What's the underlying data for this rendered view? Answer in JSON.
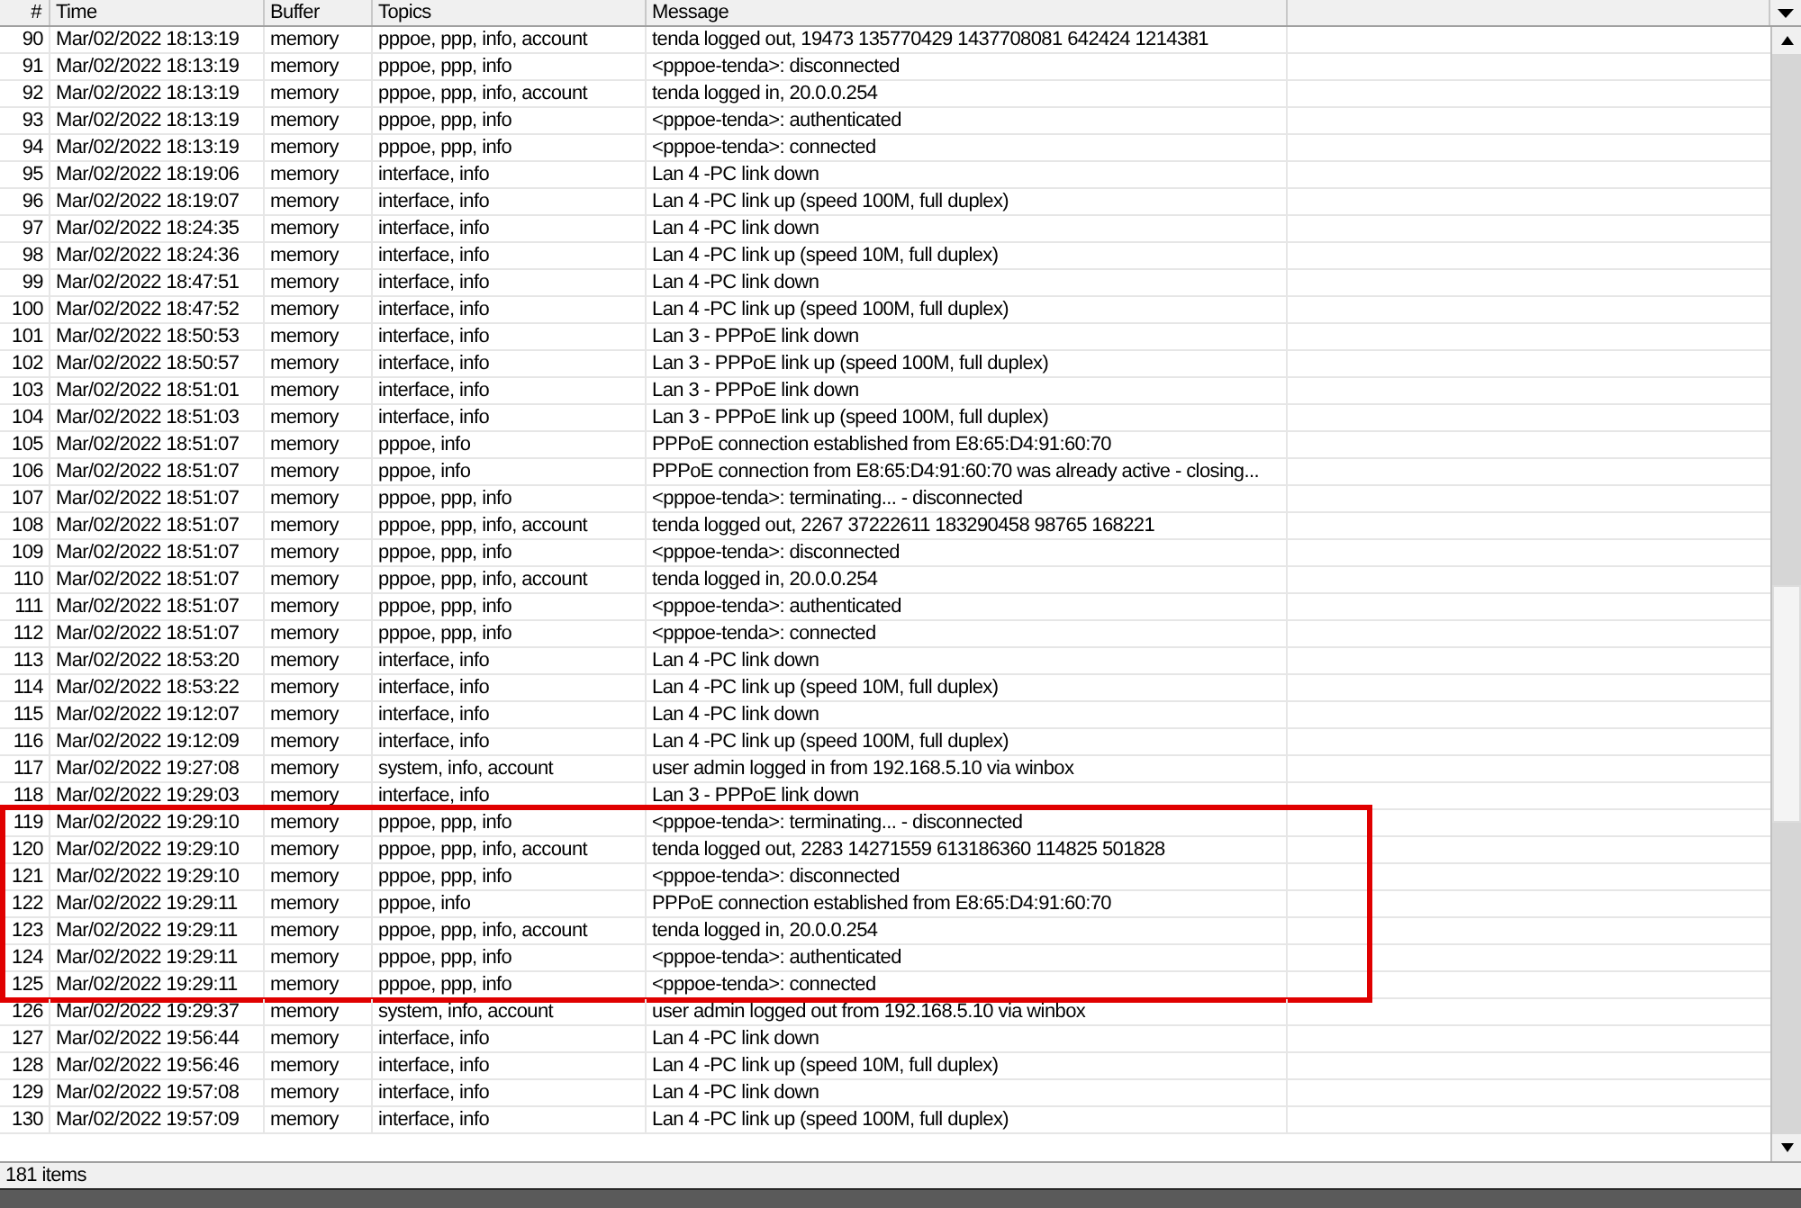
{
  "table": {
    "columns": [
      "#",
      "Time",
      "Buffer",
      "Topics",
      "Message"
    ],
    "rows": [
      {
        "num": "90",
        "time": "Mar/02/2022 18:13:19",
        "buffer": "memory",
        "topics": "pppoe, ppp, info, account",
        "message": "tenda logged out, 19473 135770429 1437708081 642424 1214381",
        "highlighted": false
      },
      {
        "num": "91",
        "time": "Mar/02/2022 18:13:19",
        "buffer": "memory",
        "topics": "pppoe, ppp, info",
        "message": "<pppoe-tenda>: disconnected",
        "highlighted": false
      },
      {
        "num": "92",
        "time": "Mar/02/2022 18:13:19",
        "buffer": "memory",
        "topics": "pppoe, ppp, info, account",
        "message": "tenda logged in, 20.0.0.254",
        "highlighted": false
      },
      {
        "num": "93",
        "time": "Mar/02/2022 18:13:19",
        "buffer": "memory",
        "topics": "pppoe, ppp, info",
        "message": "<pppoe-tenda>: authenticated",
        "highlighted": false
      },
      {
        "num": "94",
        "time": "Mar/02/2022 18:13:19",
        "buffer": "memory",
        "topics": "pppoe, ppp, info",
        "message": "<pppoe-tenda>: connected",
        "highlighted": false
      },
      {
        "num": "95",
        "time": "Mar/02/2022 18:19:06",
        "buffer": "memory",
        "topics": "interface, info",
        "message": "Lan 4 -PC link down",
        "highlighted": false
      },
      {
        "num": "96",
        "time": "Mar/02/2022 18:19:07",
        "buffer": "memory",
        "topics": "interface, info",
        "message": "Lan 4 -PC link up (speed 100M, full duplex)",
        "highlighted": false
      },
      {
        "num": "97",
        "time": "Mar/02/2022 18:24:35",
        "buffer": "memory",
        "topics": "interface, info",
        "message": "Lan 4 -PC link down",
        "highlighted": false
      },
      {
        "num": "98",
        "time": "Mar/02/2022 18:24:36",
        "buffer": "memory",
        "topics": "interface, info",
        "message": "Lan 4 -PC link up (speed 10M, full duplex)",
        "highlighted": false
      },
      {
        "num": "99",
        "time": "Mar/02/2022 18:47:51",
        "buffer": "memory",
        "topics": "interface, info",
        "message": "Lan 4 -PC link down",
        "highlighted": false
      },
      {
        "num": "100",
        "time": "Mar/02/2022 18:47:52",
        "buffer": "memory",
        "topics": "interface, info",
        "message": "Lan 4 -PC link up (speed 100M, full duplex)",
        "highlighted": false
      },
      {
        "num": "101",
        "time": "Mar/02/2022 18:50:53",
        "buffer": "memory",
        "topics": "interface, info",
        "message": "Lan 3 - PPPoE link down",
        "highlighted": false
      },
      {
        "num": "102",
        "time": "Mar/02/2022 18:50:57",
        "buffer": "memory",
        "topics": "interface, info",
        "message": "Lan 3 - PPPoE link up (speed 100M, full duplex)",
        "highlighted": false
      },
      {
        "num": "103",
        "time": "Mar/02/2022 18:51:01",
        "buffer": "memory",
        "topics": "interface, info",
        "message": "Lan 3 - PPPoE link down",
        "highlighted": false
      },
      {
        "num": "104",
        "time": "Mar/02/2022 18:51:03",
        "buffer": "memory",
        "topics": "interface, info",
        "message": "Lan 3 - PPPoE link up (speed 100M, full duplex)",
        "highlighted": false
      },
      {
        "num": "105",
        "time": "Mar/02/2022 18:51:07",
        "buffer": "memory",
        "topics": "pppoe, info",
        "message": "PPPoE connection established from E8:65:D4:91:60:70",
        "highlighted": false
      },
      {
        "num": "106",
        "time": "Mar/02/2022 18:51:07",
        "buffer": "memory",
        "topics": "pppoe, info",
        "message": "PPPoE connection from E8:65:D4:91:60:70 was already active - closing...",
        "highlighted": false
      },
      {
        "num": "107",
        "time": "Mar/02/2022 18:51:07",
        "buffer": "memory",
        "topics": "pppoe, ppp, info",
        "message": "<pppoe-tenda>: terminating... - disconnected",
        "highlighted": false
      },
      {
        "num": "108",
        "time": "Mar/02/2022 18:51:07",
        "buffer": "memory",
        "topics": "pppoe, ppp, info, account",
        "message": "tenda logged out, 2267 37222611 183290458 98765 168221",
        "highlighted": false
      },
      {
        "num": "109",
        "time": "Mar/02/2022 18:51:07",
        "buffer": "memory",
        "topics": "pppoe, ppp, info",
        "message": "<pppoe-tenda>: disconnected",
        "highlighted": false
      },
      {
        "num": "110",
        "time": "Mar/02/2022 18:51:07",
        "buffer": "memory",
        "topics": "pppoe, ppp, info, account",
        "message": "tenda logged in, 20.0.0.254",
        "highlighted": false
      },
      {
        "num": "111",
        "time": "Mar/02/2022 18:51:07",
        "buffer": "memory",
        "topics": "pppoe, ppp, info",
        "message": "<pppoe-tenda>: authenticated",
        "highlighted": false
      },
      {
        "num": "112",
        "time": "Mar/02/2022 18:51:07",
        "buffer": "memory",
        "topics": "pppoe, ppp, info",
        "message": "<pppoe-tenda>: connected",
        "highlighted": false
      },
      {
        "num": "113",
        "time": "Mar/02/2022 18:53:20",
        "buffer": "memory",
        "topics": "interface, info",
        "message": "Lan 4 -PC link down",
        "highlighted": false
      },
      {
        "num": "114",
        "time": "Mar/02/2022 18:53:22",
        "buffer": "memory",
        "topics": "interface, info",
        "message": "Lan 4 -PC link up (speed 10M, full duplex)",
        "highlighted": false
      },
      {
        "num": "115",
        "time": "Mar/02/2022 19:12:07",
        "buffer": "memory",
        "topics": "interface, info",
        "message": "Lan 4 -PC link down",
        "highlighted": false
      },
      {
        "num": "116",
        "time": "Mar/02/2022 19:12:09",
        "buffer": "memory",
        "topics": "interface, info",
        "message": "Lan 4 -PC link up (speed 100M, full duplex)",
        "highlighted": false
      },
      {
        "num": "117",
        "time": "Mar/02/2022 19:27:08",
        "buffer": "memory",
        "topics": "system, info, account",
        "message": "user admin logged in from 192.168.5.10 via winbox",
        "highlighted": false
      },
      {
        "num": "118",
        "time": "Mar/02/2022 19:29:03",
        "buffer": "memory",
        "topics": "interface, info",
        "message": "Lan 3 - PPPoE link down",
        "highlighted": false
      },
      {
        "num": "119",
        "time": "Mar/02/2022 19:29:10",
        "buffer": "memory",
        "topics": "pppoe, ppp, info",
        "message": "<pppoe-tenda>: terminating... - disconnected",
        "highlighted": true
      },
      {
        "num": "120",
        "time": "Mar/02/2022 19:29:10",
        "buffer": "memory",
        "topics": "pppoe, ppp, info, account",
        "message": "tenda logged out, 2283 14271559 613186360 114825 501828",
        "highlighted": true
      },
      {
        "num": "121",
        "time": "Mar/02/2022 19:29:10",
        "buffer": "memory",
        "topics": "pppoe, ppp, info",
        "message": "<pppoe-tenda>: disconnected",
        "highlighted": true
      },
      {
        "num": "122",
        "time": "Mar/02/2022 19:29:11",
        "buffer": "memory",
        "topics": "pppoe, info",
        "message": "PPPoE connection established from E8:65:D4:91:60:70",
        "highlighted": true
      },
      {
        "num": "123",
        "time": "Mar/02/2022 19:29:11",
        "buffer": "memory",
        "topics": "pppoe, ppp, info, account",
        "message": "tenda logged in, 20.0.0.254",
        "highlighted": true
      },
      {
        "num": "124",
        "time": "Mar/02/2022 19:29:11",
        "buffer": "memory",
        "topics": "pppoe, ppp, info",
        "message": "<pppoe-tenda>: authenticated",
        "highlighted": true
      },
      {
        "num": "125",
        "time": "Mar/02/2022 19:29:11",
        "buffer": "memory",
        "topics": "pppoe, ppp, info",
        "message": "<pppoe-tenda>: connected",
        "highlighted": true
      },
      {
        "num": "126",
        "time": "Mar/02/2022 19:29:37",
        "buffer": "memory",
        "topics": "system, info, account",
        "message": "user admin logged out from 192.168.5.10 via winbox",
        "highlighted": false
      },
      {
        "num": "127",
        "time": "Mar/02/2022 19:56:44",
        "buffer": "memory",
        "topics": "interface, info",
        "message": "Lan 4 -PC link down",
        "highlighted": false
      },
      {
        "num": "128",
        "time": "Mar/02/2022 19:56:46",
        "buffer": "memory",
        "topics": "interface, info",
        "message": "Lan 4 -PC link up (speed 10M, full duplex)",
        "highlighted": false
      },
      {
        "num": "129",
        "time": "Mar/02/2022 19:57:08",
        "buffer": "memory",
        "topics": "interface, info",
        "message": "Lan 4 -PC link down",
        "highlighted": false
      },
      {
        "num": "130",
        "time": "Mar/02/2022 19:57:09",
        "buffer": "memory",
        "topics": "interface, info",
        "message": "Lan 4 -PC link up (speed 100M, full duplex)",
        "highlighted": false
      }
    ]
  },
  "status_bar": {
    "count": "181 items"
  }
}
